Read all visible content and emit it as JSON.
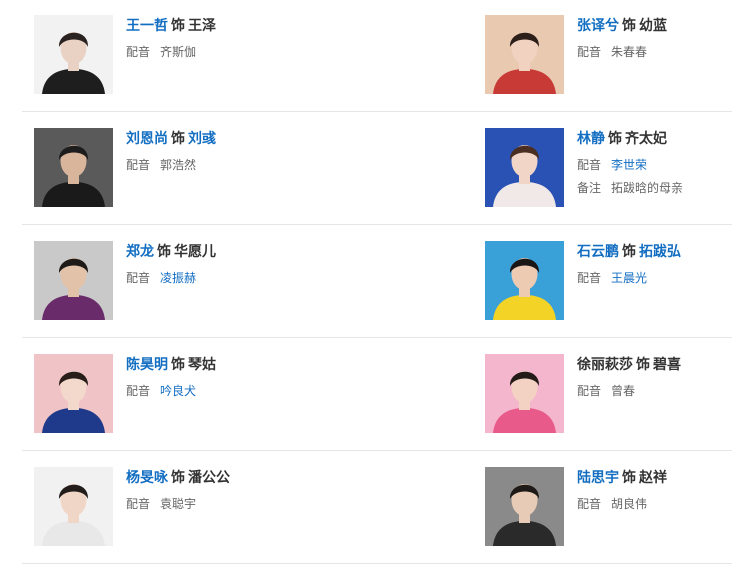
{
  "shi_label": "饰",
  "dub_key": "配音",
  "note_key": "备注",
  "cast": [
    {
      "actor": "王一哲",
      "actor_link": true,
      "role": "王泽",
      "role_link": false,
      "dub": "齐斯伽",
      "dub_link": false,
      "photo": {
        "bg": "#f2f2f2",
        "shirt": "#1e1e1e",
        "skin": "#e9d2c4",
        "hair": "#2a2220"
      }
    },
    {
      "actor": "张译兮",
      "actor_link": true,
      "role": "幼蓝",
      "role_link": false,
      "dub": "朱春春",
      "dub_link": false,
      "photo": {
        "bg": "#e9c9b0",
        "shirt": "#c83a36",
        "skin": "#f1d2c0",
        "hair": "#2c1e18"
      }
    },
    {
      "actor": "刘恩尚",
      "actor_link": true,
      "role": "刘彧",
      "role_link": true,
      "dub": "郭浩然",
      "dub_link": false,
      "photo": {
        "bg": "#5a5a5a",
        "shirt": "#1a1a1a",
        "skin": "#d9b59b",
        "hair": "#1d1d1d"
      }
    },
    {
      "actor": "林静",
      "actor_link": true,
      "role": "齐太妃",
      "role_link": false,
      "dub": "李世荣",
      "dub_link": true,
      "note": "拓跋晗的母亲",
      "photo": {
        "bg": "#2a52b5",
        "shirt": "#f1e8e8",
        "skin": "#f1d6c8",
        "hair": "#4a2e22"
      }
    },
    {
      "actor": "郑龙",
      "actor_link": true,
      "role": "华愿儿",
      "role_link": false,
      "dub": "凌振赫",
      "dub_link": true,
      "photo": {
        "bg": "#c9c9c9",
        "shirt": "#6a2b6a",
        "skin": "#e2c2a8",
        "hair": "#1e1a18"
      }
    },
    {
      "actor": "石云鹏",
      "actor_link": true,
      "role": "拓跋弘",
      "role_link": true,
      "dub": "王晨光",
      "dub_link": true,
      "photo": {
        "bg": "#3aa0d8",
        "shirt": "#f3d326",
        "skin": "#edcab2",
        "hair": "#1a1616"
      }
    },
    {
      "actor": "陈昊明",
      "actor_link": true,
      "role": "琴姑",
      "role_link": false,
      "dub": "吟良犬",
      "dub_link": true,
      "photo": {
        "bg": "#f0c3c6",
        "shirt": "#1f3a8a",
        "skin": "#f3d9cc",
        "hair": "#2a1e1a"
      }
    },
    {
      "actor": "徐丽萩莎",
      "actor_link": false,
      "role": "碧喜",
      "role_link": false,
      "dub": "曾春",
      "dub_link": false,
      "photo": {
        "bg": "#f4b6cc",
        "shirt": "#e85a8a",
        "skin": "#f3d2c4",
        "hair": "#241a18"
      }
    },
    {
      "actor": "杨旻咏",
      "actor_link": true,
      "role": "潘公公",
      "role_link": false,
      "dub": "袁聪宇",
      "dub_link": false,
      "photo": {
        "bg": "#f1f1f1",
        "shirt": "#e8e8e8",
        "skin": "#f0d6c6",
        "hair": "#221c1a"
      }
    },
    {
      "actor": "陆思宇",
      "actor_link": true,
      "role": "赵祥",
      "role_link": false,
      "dub": "胡良伟",
      "dub_link": false,
      "photo": {
        "bg": "#8a8a8a",
        "shirt": "#2a2a2a",
        "skin": "#e7cbb6",
        "hair": "#1d1a18"
      }
    }
  ]
}
